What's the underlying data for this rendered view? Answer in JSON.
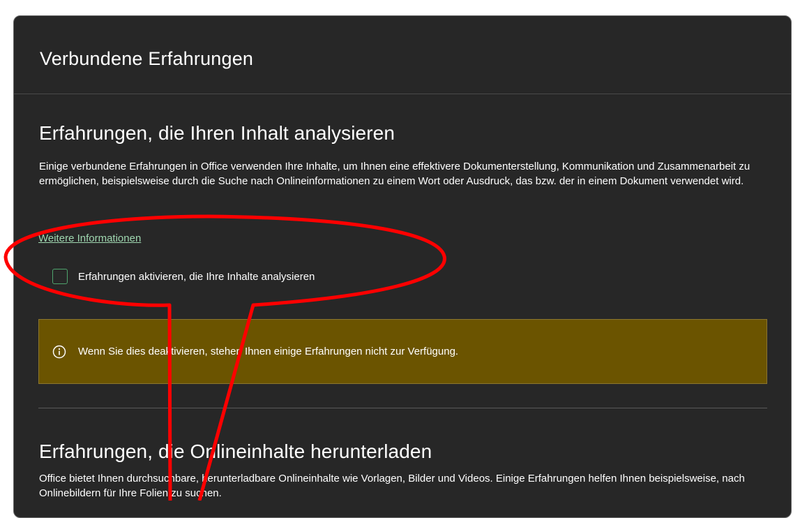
{
  "dialog": {
    "title": "Verbundene Erfahrungen"
  },
  "section_analyze": {
    "heading": "Erfahrungen, die Ihren Inhalt analysieren",
    "description": "Einige verbundene Erfahrungen in Office verwenden Ihre Inhalte, um Ihnen eine effektivere Dokumenterstellung, Kommunikation und Zusammenarbeit zu ermöglichen, beispielsweise durch die Suche nach Onlineinformationen zu einem Wort oder Ausdruck, das bzw. der in einem Dokument verwendet wird.",
    "link_label": "Weitere Informationen",
    "checkbox_label": "Erfahrungen aktivieren, die Ihre Inhalte analysieren",
    "checkbox_checked": false,
    "warning_icon": "info-icon",
    "warning_text": "Wenn Sie dies deaktivieren, stehen Ihnen einige Erfahrungen nicht zur Verfügung."
  },
  "section_download": {
    "heading": "Erfahrungen, die Onlineinhalte herunterladen",
    "description": "Office bietet Ihnen durchsuchbare, herunterladbare Onlineinhalte wie Vorlagen, Bilder und Videos. Einige Erfahrungen helfen Ihnen beispielsweise, nach Onlinebildern für Ihre Folien zu suchen."
  },
  "colors": {
    "background": "#272727",
    "link": "#9fd7b0",
    "checkbox_border": "#4fa46d",
    "warning_background": "#6b5400",
    "annotation": "#ff0000"
  }
}
